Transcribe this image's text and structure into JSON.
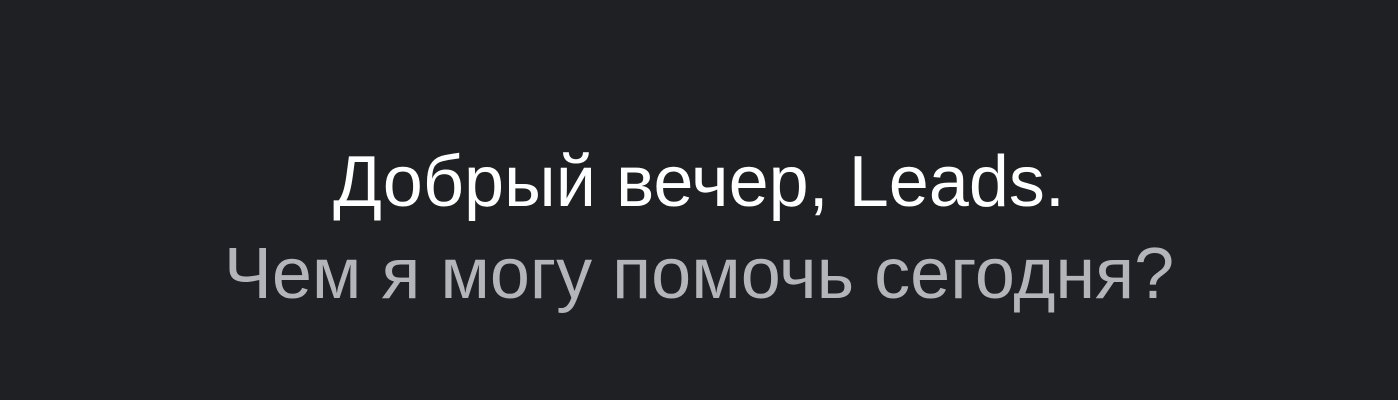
{
  "greeting": {
    "headline": "Добрый вечер, Leads.",
    "subheadline": "Чем я могу помочь сегодня?"
  },
  "colors": {
    "background": "#1f2023",
    "headline": "#ffffff",
    "subheadline": "#b4b5ba"
  }
}
